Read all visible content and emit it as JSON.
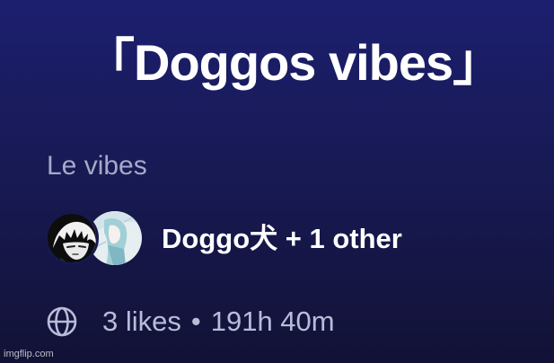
{
  "playlist": {
    "title": "「Doggos vibes」",
    "description": "Le vibes",
    "owners_text": "Doggo犬 + 1 other",
    "likes": "3 likes",
    "separator": "•",
    "duration": "191h 40m"
  },
  "icons": {
    "visibility": "globe-icon"
  },
  "watermark": "imgflip.com",
  "colors": {
    "background_top": "#1c1f6e",
    "background_bottom": "#121236",
    "title": "#ffffff",
    "description": "#a6a9c8",
    "meta": "#b9bcd8"
  }
}
